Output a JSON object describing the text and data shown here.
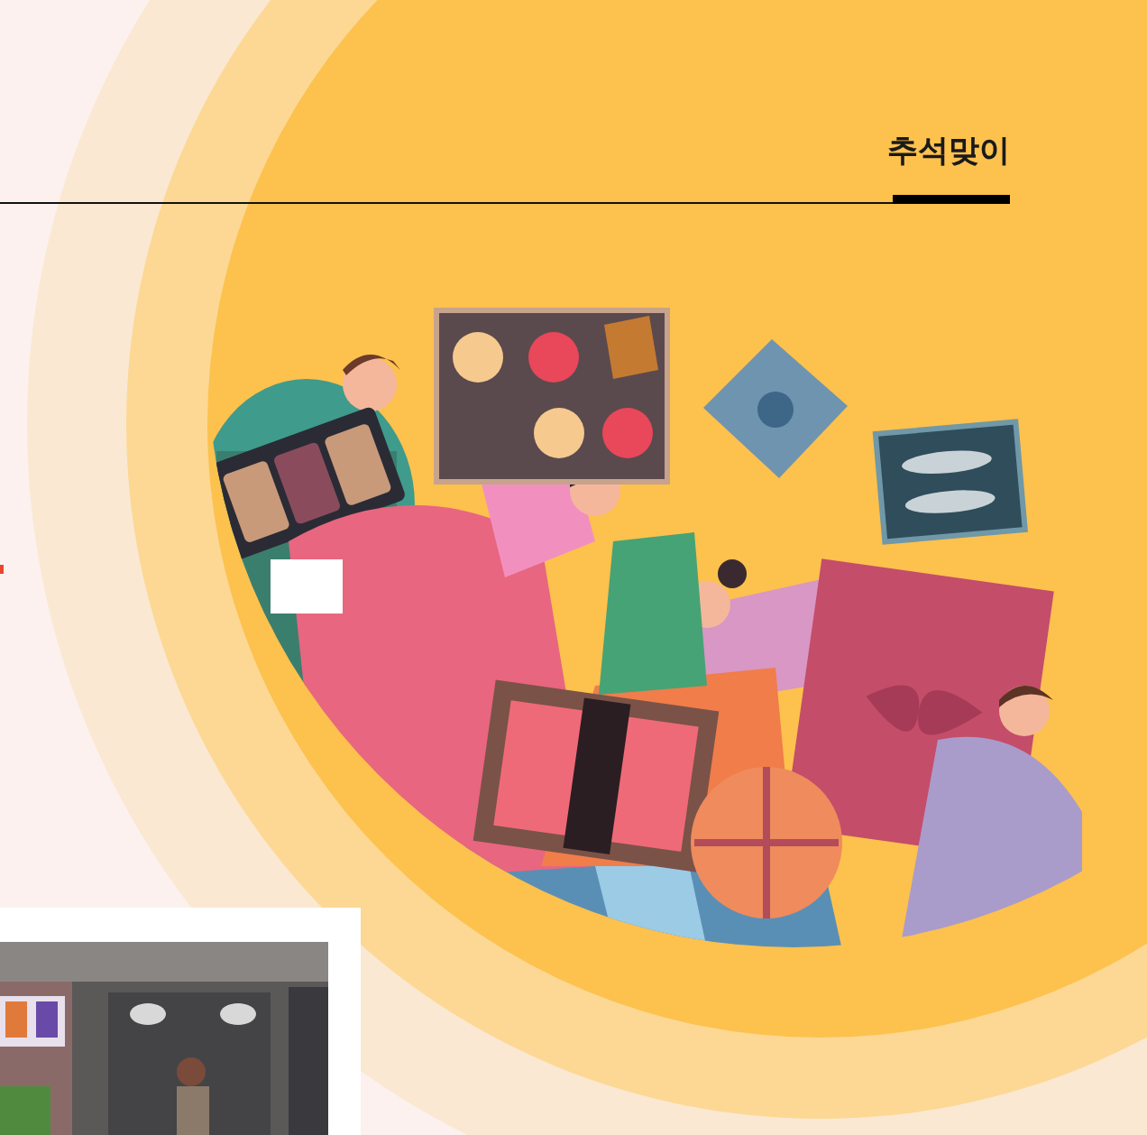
{
  "heading": {
    "title": "추석맞이"
  }
}
